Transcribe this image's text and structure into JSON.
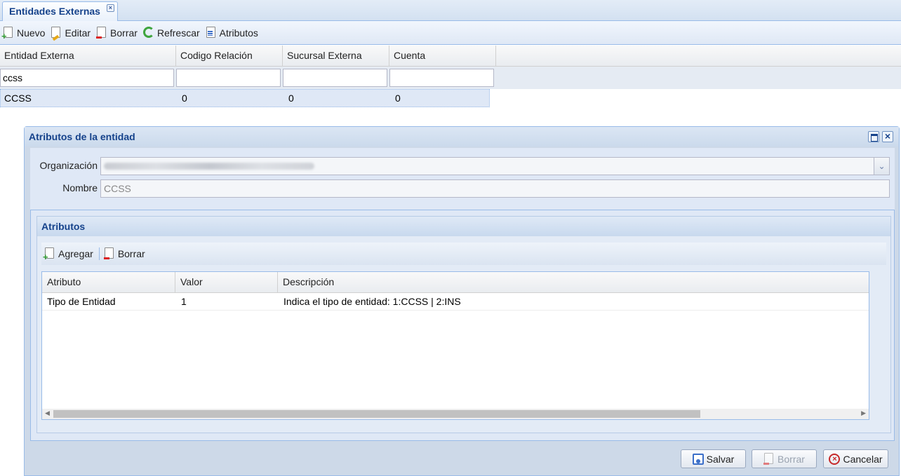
{
  "tab": {
    "label": "Entidades Externas",
    "close": "×"
  },
  "toolbar": {
    "nuevo": "Nuevo",
    "editar": "Editar",
    "borrar": "Borrar",
    "refrescar": "Refrescar",
    "atributos": "Atributos"
  },
  "grid": {
    "columns": [
      "Entidad Externa",
      "Codigo Relación",
      "Sucursal Externa",
      "Cuenta"
    ],
    "filters": [
      "ccss",
      "",
      "",
      ""
    ],
    "rows": [
      {
        "entidad": "CCSS",
        "codigo": "0",
        "sucursal": "0",
        "cuenta": "0"
      }
    ]
  },
  "window": {
    "title": "Atributos de la entidad",
    "organizacion_label": "Organización",
    "nombre_label": "Nombre",
    "nombre_value": "CCSS",
    "atributos_title": "Atributos",
    "agregar": "Agregar",
    "borrar": "Borrar",
    "attr_columns": [
      "Atributo",
      "Valor",
      "Descripción"
    ],
    "attr_rows": [
      {
        "atributo": "Tipo de Entidad",
        "valor": "1",
        "descripcion": "Indica el tipo de entidad: 1:CCSS | 2:INS"
      }
    ],
    "salvar": "Salvar",
    "borrar_footer": "Borrar",
    "cancelar": "Cancelar"
  },
  "icons": {
    "add": "document-add-icon",
    "edit": "document-edit-icon",
    "delete": "document-delete-icon",
    "refresh": "refresh-icon",
    "attributes": "document-list-icon"
  }
}
